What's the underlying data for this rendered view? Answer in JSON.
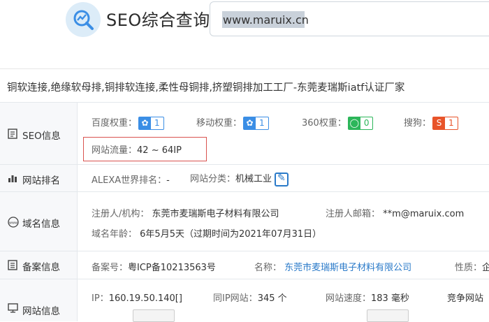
{
  "header": {
    "brand": "SEO综合查询",
    "logo_icon": "chart-magnifier-icon",
    "search_value": "www.maruix.cn"
  },
  "site_title": "铜软连接,绝缘软母排,铜排软连接,柔性母铜排,挤塑铜排加工工厂-东莞麦瑞斯iatf认证厂家",
  "rows": {
    "seo": {
      "label": "SEO信息",
      "baidu_label": "百度权重：",
      "baidu_value": "1",
      "mobile_label": "移动权重：",
      "mobile_value": "1",
      "s360_label": "360权重：",
      "s360_value": "0",
      "sogou_label": "搜狗：",
      "sogou_value": "1",
      "traffic_label": "网站流量：",
      "traffic_value": "42 ~ 64IP"
    },
    "rank": {
      "label": "网站排名",
      "alexa_label": "ALEXA世界排名：",
      "alexa_value": "-",
      "category_label": "网站分类：",
      "category_value": "机械工业"
    },
    "domain": {
      "label": "域名信息",
      "registrant_label": "注册人/机构：",
      "registrant_value": "东莞市麦瑞斯电子材料有限公司",
      "email_label": "注册人邮箱：",
      "email_value": "**m@maruix.com",
      "age_label": "域名年龄：",
      "age_value": "6年5月5天（过期时间为2021年07月31日）"
    },
    "icp": {
      "label": "备案信息",
      "number_label": "备案号：",
      "number_value": "粤ICP备10213563号",
      "name_label": "名称：",
      "name_value": "东莞市麦瑞斯电子材料有限公司",
      "nature_label": "性质：",
      "nature_value": "企"
    },
    "site": {
      "label": "网站信息",
      "ip_label": "IP：",
      "ip_value": "160.19.50.140[]",
      "sameip_label": "同IP网站：",
      "sameip_value": "345 个",
      "speed_label": "网站速度：",
      "speed_value": "183 毫秒",
      "compete_label": "竞争网站"
    }
  }
}
